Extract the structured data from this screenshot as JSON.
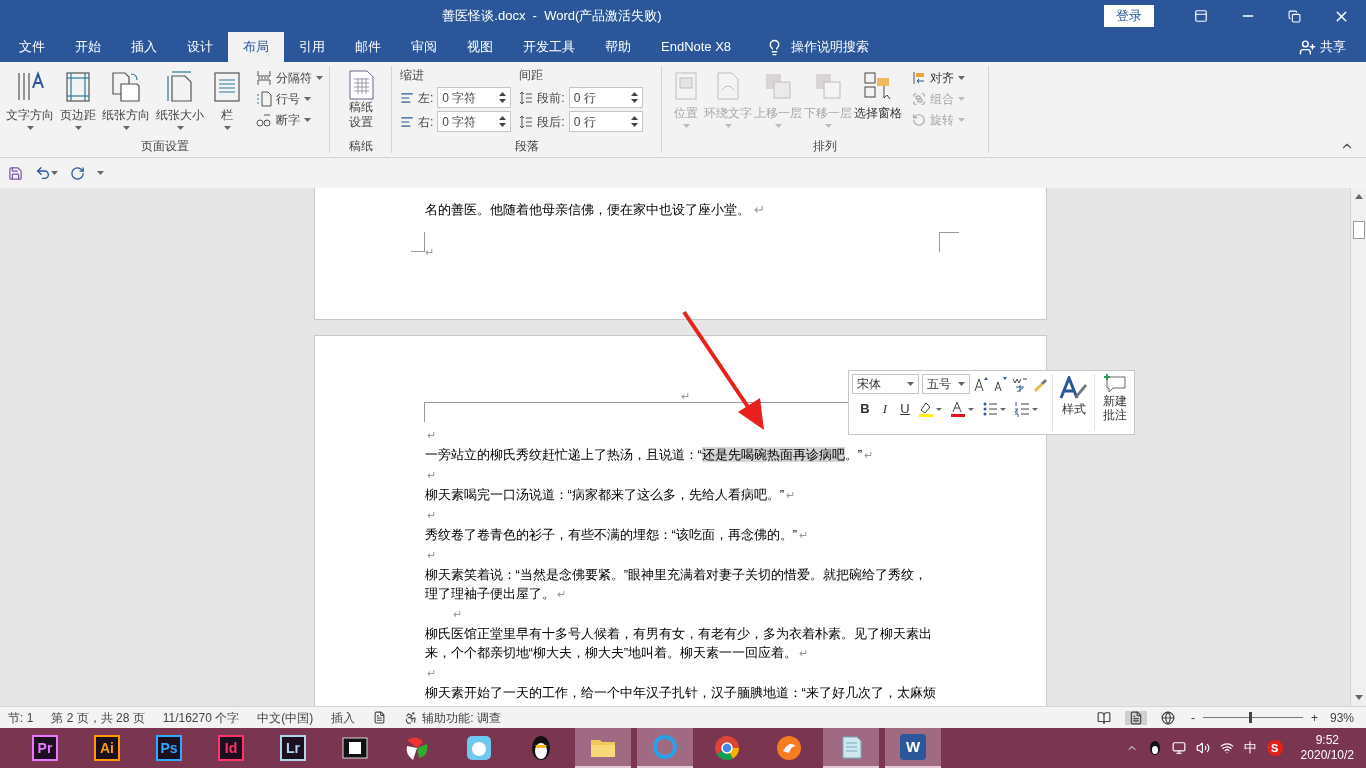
{
  "window": {
    "title": "善医怪谈.docx  -  Word(产品激活失败)",
    "login": "登录"
  },
  "tabs": [
    {
      "label": "文件",
      "selected": false
    },
    {
      "label": "开始",
      "selected": false
    },
    {
      "label": "插入",
      "selected": false
    },
    {
      "label": "设计",
      "selected": false
    },
    {
      "label": "布局",
      "selected": true
    },
    {
      "label": "引用",
      "selected": false
    },
    {
      "label": "邮件",
      "selected": false
    },
    {
      "label": "审阅",
      "selected": false
    },
    {
      "label": "视图",
      "selected": false
    },
    {
      "label": "开发工具",
      "selected": false
    },
    {
      "label": "帮助",
      "selected": false
    },
    {
      "label": "EndNote X8",
      "selected": false
    }
  ],
  "tell_me": "操作说明搜索",
  "share": "共享",
  "ribbon": {
    "page_setup": {
      "label": "页面设置",
      "big": [
        {
          "label": "文字方向",
          "kind": "textdir"
        },
        {
          "label": "页边距",
          "kind": "margins"
        },
        {
          "label": "纸张方向",
          "kind": "orientation"
        },
        {
          "label": "纸张大小",
          "kind": "size"
        },
        {
          "label": "栏",
          "kind": "columns"
        }
      ],
      "small": [
        {
          "label": "分隔符",
          "kind": "breaks"
        },
        {
          "label": "行号",
          "kind": "linenumbers"
        },
        {
          "label": "断字",
          "kind": "hyphen"
        }
      ]
    },
    "manuscript": {
      "label": "稿纸",
      "button": [
        "稿纸",
        "设置"
      ]
    },
    "paragraph": {
      "label": "段落",
      "indent": {
        "title": "缩进",
        "left_label": "左:",
        "left": "0 字符",
        "right_label": "右:",
        "right": "0 字符"
      },
      "spacing": {
        "title": "间距",
        "before_label": "段前:",
        "before": "0 行",
        "after_label": "段后:",
        "after": "0 行"
      }
    },
    "arrange": {
      "label": "排列",
      "big": [
        {
          "label": "位置",
          "disabled": true
        },
        {
          "label": "环绕文字",
          "disabled": true
        },
        {
          "label": "上移一层",
          "disabled": true
        },
        {
          "label": "下移一层",
          "disabled": true
        },
        {
          "label": "选择窗格",
          "disabled": false
        }
      ],
      "small": [
        {
          "label": "对齐",
          "disabled": false
        },
        {
          "label": "组合",
          "disabled": true
        },
        {
          "label": "旋转",
          "disabled": true
        }
      ]
    }
  },
  "page1": {
    "text": "名的善医。他随着他母亲信佛，便在家中也设了座小堂。",
    "mark": "↵",
    "end_mark": "↵"
  },
  "page2": {
    "header_mark": "↵",
    "paragraphs": [
      {
        "indent": false,
        "mark": "↵"
      },
      {
        "indent": false,
        "segments": [
          {
            "text": "一旁站立的柳氏秀纹赶忙递上了热汤，且说道：“",
            "selected": false
          },
          {
            "text": "还是先喝碗热面再诊病吧",
            "selected": true
          },
          {
            "text": "。”",
            "selected": false
          }
        ],
        "mark": "↵"
      },
      {
        "indent": false,
        "mark": "↵"
      },
      {
        "indent": false,
        "segments": [
          {
            "text": "柳天素喝完一口汤说道：“病家都来了这么多，先给人看病吧。”",
            "selected": false
          }
        ],
        "mark": "↵"
      },
      {
        "indent": false,
        "mark": "↵"
      },
      {
        "indent": false,
        "segments": [
          {
            "text": "秀纹卷了卷青色的衫子，有些不满的埋怨：“该吃面，再念佛的。”",
            "selected": false
          }
        ],
        "mark": "↵"
      },
      {
        "indent": false,
        "mark": "↵"
      },
      {
        "indent": false,
        "segments": [
          {
            "text": "柳天素笑着说：“当然是念佛要紧。”眼神里充满着对妻子关切的惜爱。就把碗给了秀纹，理了理袖子便出屋了。",
            "selected": false
          }
        ],
        "mark": "↵"
      },
      {
        "indent": true,
        "mark": "↵"
      },
      {
        "indent": false,
        "segments": [
          {
            "text": "柳氏医馆正堂里早有十多号人候着，有男有女，有老有少，多为衣着朴素。见了柳天素出来，个个都亲切地“柳大夫，柳大夫”地叫着。柳天素一一回应着。",
            "selected": false
          }
        ],
        "mark": "↵"
      },
      {
        "indent": false,
        "mark": "↵"
      },
      {
        "indent": false,
        "segments": [
          {
            "text": "柳天素开始了一天的工作，给一个中年汉子扎针，汉子腼腆地道：“来了好几次了，太麻烦",
            "selected": false
          }
        ]
      }
    ]
  },
  "mini_toolbar": {
    "font": "宋体",
    "size": "五号",
    "bold": "B",
    "italic": "I",
    "underline": "U",
    "styles": "样式",
    "comment": [
      "新建",
      "批注"
    ]
  },
  "status_bar": {
    "items": [
      "节: 1",
      "第 2 页，共 28 页",
      "11/16270 个字",
      "中文(中国)",
      "插入"
    ],
    "accessibility": "辅助功能: 调查",
    "zoom_out": "-",
    "zoom_in": "+",
    "zoom": {
      "level": 0.47
    },
    "zoom_text": "93%"
  },
  "taskbar": {
    "apps": [
      {
        "kind": "label",
        "label": "Pr",
        "color": "#ea77ff",
        "selected": false
      },
      {
        "kind": "label",
        "label": "Ai",
        "color": "#ff9a00",
        "selected": false
      },
      {
        "kind": "label",
        "label": "Ps",
        "color": "#31a8ff",
        "selected": false
      },
      {
        "kind": "label",
        "label": "Id",
        "color": "#ff3366",
        "selected": false
      },
      {
        "kind": "label",
        "label": "Lr",
        "color": "#add5ec",
        "selected": false
      },
      {
        "kind": "film",
        "selected": false
      },
      {
        "kind": "fan",
        "selected": false
      },
      {
        "kind": "bird",
        "selected": false
      },
      {
        "kind": "penguin",
        "selected": false
      },
      {
        "kind": "folder",
        "selected": true
      },
      {
        "kind": "ring",
        "selected": true
      },
      {
        "kind": "chrome",
        "selected": false
      },
      {
        "kind": "fox",
        "selected": false
      },
      {
        "kind": "notepad",
        "selected": true
      },
      {
        "kind": "word",
        "label": "W",
        "selected": true
      }
    ],
    "ime": "中",
    "ime_logo": "S",
    "time": "9:52",
    "date": "2020/10/2"
  }
}
